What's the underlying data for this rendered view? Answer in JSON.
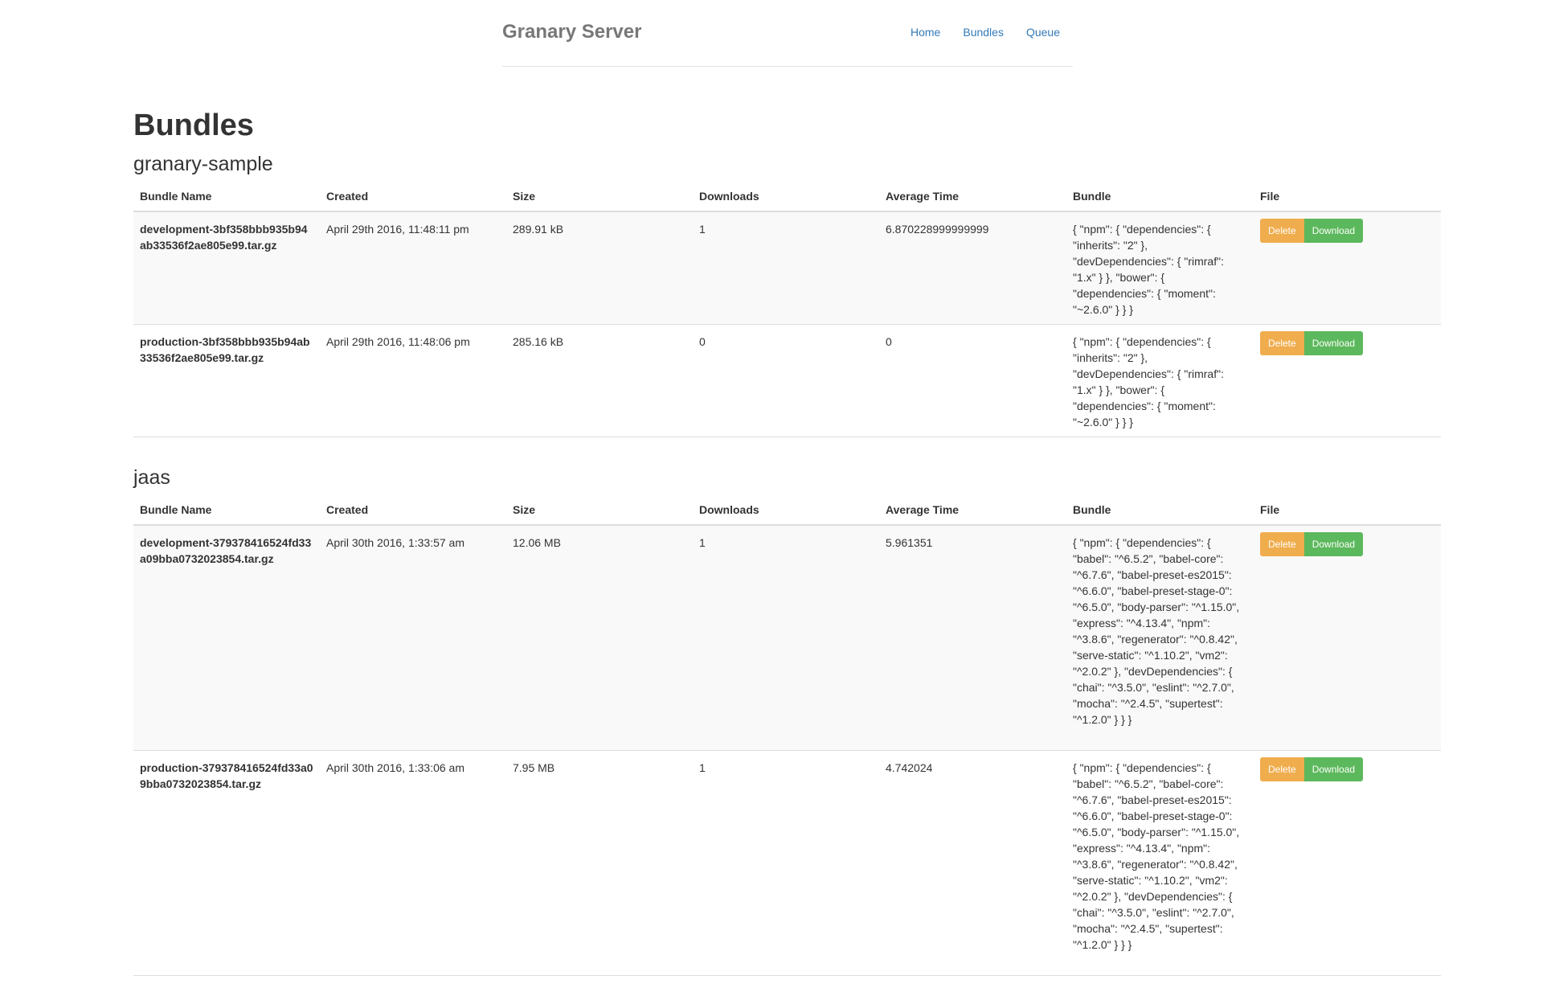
{
  "nav": {
    "brand": "Granary Server",
    "links": [
      "Home",
      "Bundles",
      "Queue"
    ]
  },
  "page": {
    "title": "Bundles"
  },
  "columns": [
    "Bundle Name",
    "Created",
    "Size",
    "Downloads",
    "Average Time",
    "Bundle",
    "File"
  ],
  "buttons": {
    "delete": "Delete",
    "download": "Download"
  },
  "groups": [
    {
      "name": "granary-sample",
      "rows": [
        {
          "name": "development-3bf358bbb935b94ab33536f2ae805e99.tar.gz",
          "created": "April 29th 2016, 11:48:11 pm",
          "size": "289.91 kB",
          "downloads": "1",
          "avg_time": "6.870228999999999",
          "bundle": "{ \"npm\": { \"dependencies\": { \"inherits\": \"2\" }, \"devDependencies\": { \"rimraf\": \"1.x\" } }, \"bower\": { \"dependencies\": { \"moment\": \"~2.6.0\" } } }"
        },
        {
          "name": "production-3bf358bbb935b94ab33536f2ae805e99.tar.gz",
          "created": "April 29th 2016, 11:48:06 pm",
          "size": "285.16 kB",
          "downloads": "0",
          "avg_time": "0",
          "bundle": "{ \"npm\": { \"dependencies\": { \"inherits\": \"2\" }, \"devDependencies\": { \"rimraf\": \"1.x\" } }, \"bower\": { \"dependencies\": { \"moment\": \"~2.6.0\" } } }"
        }
      ]
    },
    {
      "name": "jaas",
      "rows": [
        {
          "name": "development-379378416524fd33a09bba0732023854.tar.gz",
          "created": "April 30th 2016, 1:33:57 am",
          "size": "12.06 MB",
          "downloads": "1",
          "avg_time": "5.961351",
          "bundle": "{ \"npm\": { \"dependencies\": { \"babel\": \"^6.5.2\", \"babel-core\": \"^6.7.6\", \"babel-preset-es2015\": \"^6.6.0\", \"babel-preset-stage-0\": \"^6.5.0\", \"body-parser\": \"^1.15.0\", \"express\": \"^4.13.4\", \"npm\": \"^3.8.6\", \"regenerator\": \"^0.8.42\", \"serve-static\": \"^1.10.2\", \"vm2\": \"^2.0.2\" }, \"devDependencies\": { \"chai\": \"^3.5.0\", \"eslint\": \"^2.7.0\", \"mocha\": \"^2.4.5\", \"supertest\": \"^1.2.0\" } } }"
        },
        {
          "name": "production-379378416524fd33a09bba0732023854.tar.gz",
          "created": "April 30th 2016, 1:33:06 am",
          "size": "7.95 MB",
          "downloads": "1",
          "avg_time": "4.742024",
          "bundle": "{ \"npm\": { \"dependencies\": { \"babel\": \"^6.5.2\", \"babel-core\": \"^6.7.6\", \"babel-preset-es2015\": \"^6.6.0\", \"babel-preset-stage-0\": \"^6.5.0\", \"body-parser\": \"^1.15.0\", \"express\": \"^4.13.4\", \"npm\": \"^3.8.6\", \"regenerator\": \"^0.8.42\", \"serve-static\": \"^1.10.2\", \"vm2\": \"^2.0.2\" }, \"devDependencies\": { \"chai\": \"^3.5.0\", \"eslint\": \"^2.7.0\", \"mocha\": \"^2.4.5\", \"supertest\": \"^1.2.0\" } } }"
        }
      ]
    }
  ]
}
